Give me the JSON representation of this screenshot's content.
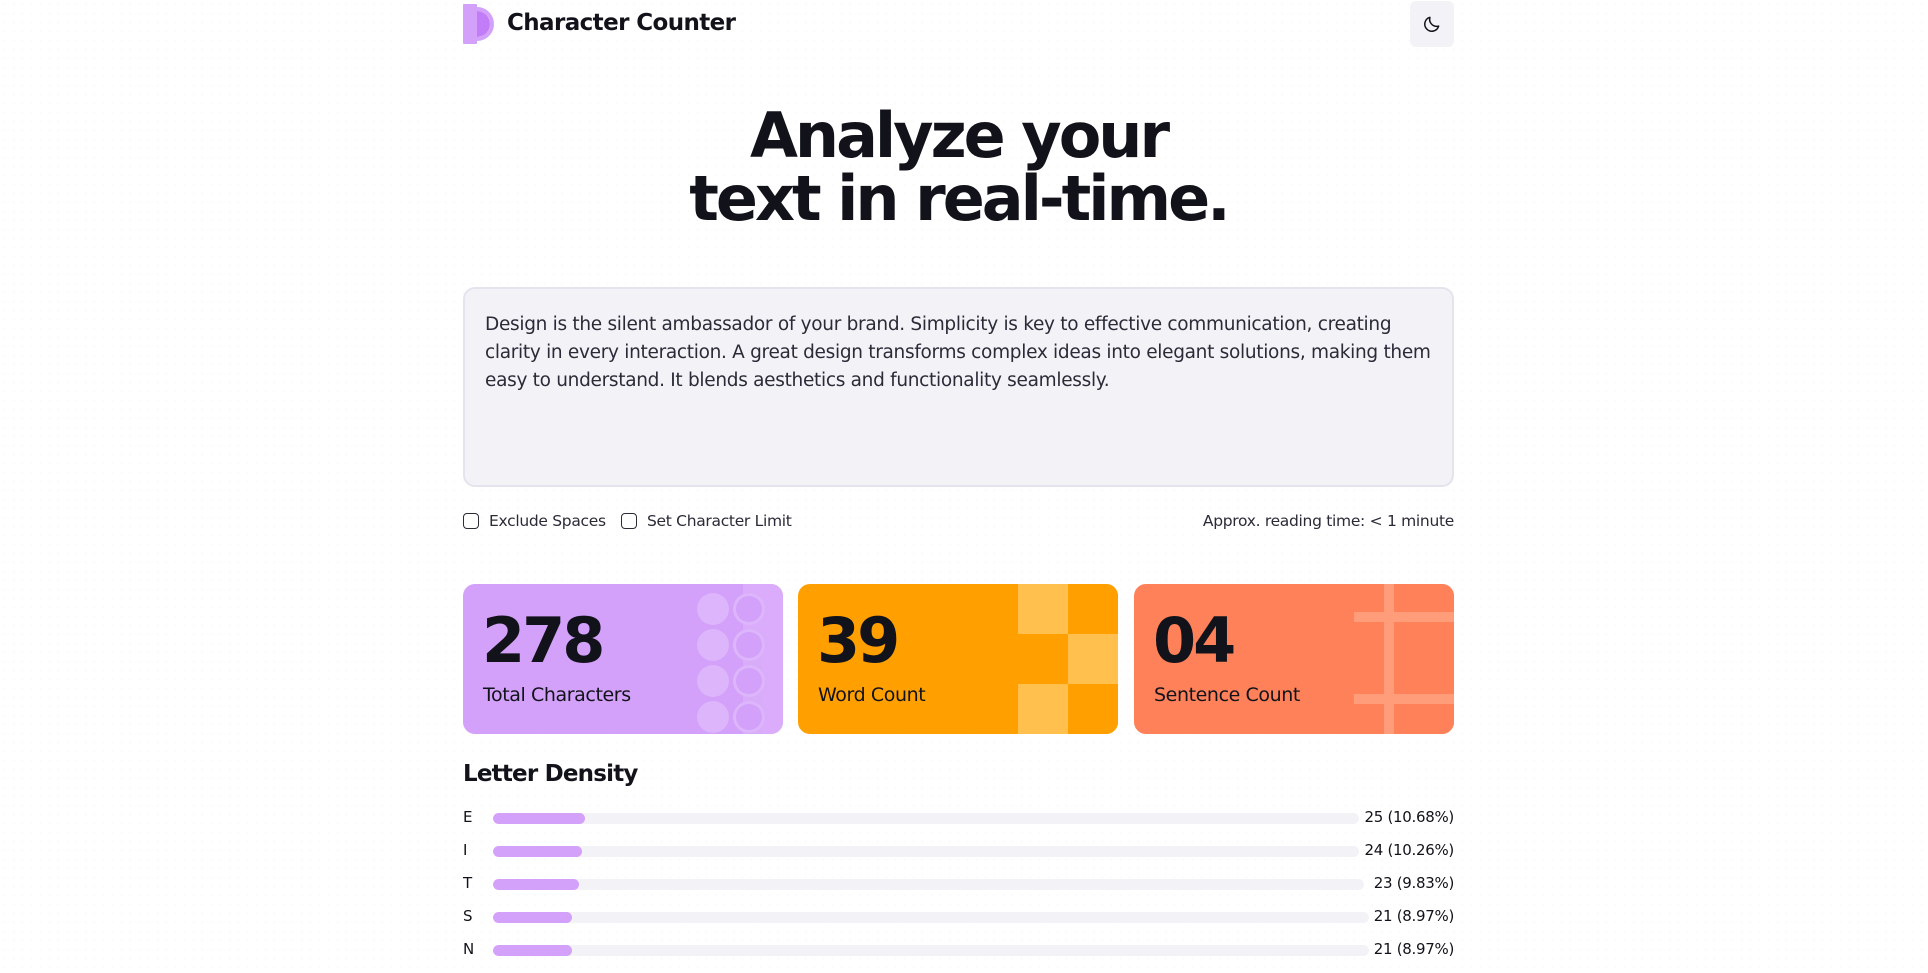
{
  "header": {
    "app_title": "Character Counter",
    "logo_icon": "half-circle-logo-icon",
    "theme_toggle_icon": "moon-icon"
  },
  "hero": {
    "line1": "Analyze your",
    "line2": "text in real-time."
  },
  "editor": {
    "value": "Design is the silent ambassador of your brand. Simplicity is key to effective communication, creating clarity in every interaction. A great design transforms complex ideas into elegant solutions, making them easy to understand. It blends aesthetics and functionality seamlessly."
  },
  "options": {
    "exclude_spaces_label": "Exclude Spaces",
    "exclude_spaces_checked": false,
    "char_limit_label": "Set Character Limit",
    "char_limit_checked": false,
    "reading_time_label": "Approx. reading time:",
    "reading_time_value": "< 1 minute"
  },
  "stats": [
    {
      "value": "278",
      "label": "Total Characters",
      "color": "#d3a0fa"
    },
    {
      "value": "39",
      "label": "Word Count",
      "color": "#ff9f00"
    },
    {
      "value": "04",
      "label": "Sentence Count",
      "color": "#fe8159"
    }
  ],
  "density": {
    "title": "Letter Density",
    "items": [
      {
        "letter": "E",
        "count_text": "25 (10.68%)",
        "percent": 10.68
      },
      {
        "letter": "I",
        "count_text": "24 (10.26%)",
        "percent": 10.26
      },
      {
        "letter": "T",
        "count_text": "23 (9.83%)",
        "percent": 9.83
      },
      {
        "letter": "S",
        "count_text": "21 (8.97%)",
        "percent": 8.97
      },
      {
        "letter": "N",
        "count_text": "21 (8.97%)",
        "percent": 8.97
      }
    ]
  },
  "colors": {
    "accent_purple": "#d3a0fa",
    "accent_orange": "#ff9f00",
    "accent_coral": "#fe8159",
    "text_dark": "#12131a",
    "surface": "#f2f2f7"
  }
}
